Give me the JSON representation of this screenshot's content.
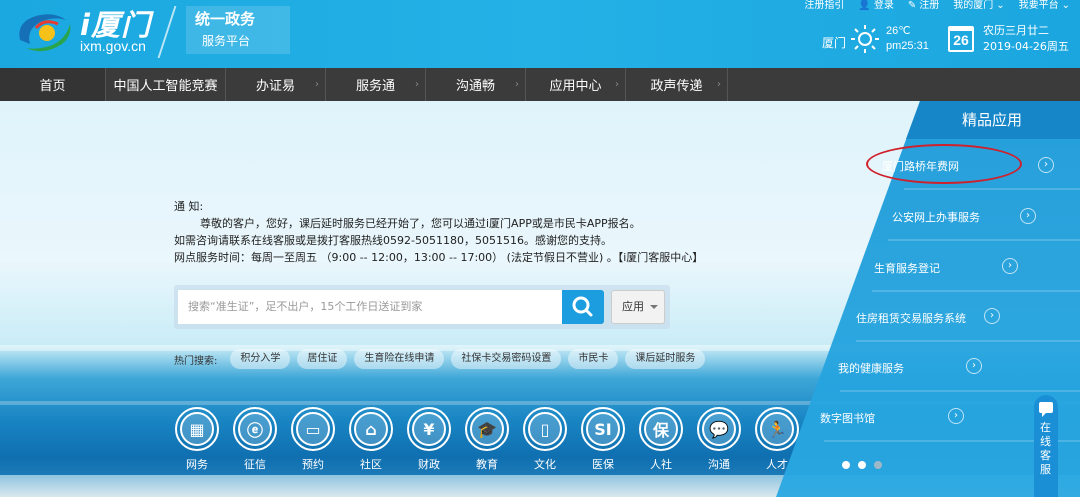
{
  "header": {
    "logo_title": "i厦门",
    "logo_domain": "ixm.gov.cn",
    "slogan_line1": "统一政务",
    "slogan_line2": "服务平台",
    "toplinks": [
      "注册指引",
      "登录",
      "注册",
      "我的厦门",
      "我要平台"
    ],
    "weather": {
      "city": "厦门",
      "temp": "26℃",
      "time": "pm25:31"
    },
    "calendar_day": "26",
    "lunar_date": "农历三月廿二",
    "solar_date": "2019-04-26周五"
  },
  "nav": {
    "items": [
      "首页",
      "中国人工智能竞赛",
      "办证易",
      "服务通",
      "沟通畅",
      "应用中心",
      "政声传递"
    ]
  },
  "notice": {
    "title": "通 知:",
    "line1": "尊敬的客户，您好，课后延时服务已经开始了，您可以通过i厦门APP或是市民卡APP报名。",
    "line2": "如需咨询请联系在线客服或是拨打客服热线0592-5051180，5051516。感谢您的支持。",
    "line3": "网点服务时间：每周一至周五 （9:00 -- 12:00，13:00 -- 17:00） (法定节假日不营业) 。【i厦门客服中心】"
  },
  "search": {
    "placeholder": "搜索“准生证”，足不出户，15个工作日送证到家",
    "select_value": "应用"
  },
  "hot": {
    "label": "热门搜索:",
    "tags": [
      "积分入学",
      "居住证",
      "生育险在线申请",
      "社保卡交易密码设置",
      "市民卡",
      "课后延时服务"
    ]
  },
  "services": [
    "网务",
    "征信",
    "预约",
    "社区",
    "财政",
    "教育",
    "文化",
    "医保",
    "人社",
    "沟通",
    "人才"
  ],
  "panel": {
    "title": "精品应用",
    "items": [
      "厦门路桥年费网",
      "公安网上办事服务",
      "生育服务登记",
      "住房租赁交易服务系统",
      "我的健康服务",
      "数字图书馆"
    ]
  },
  "kefu_label": "在线客服",
  "colors": {
    "brand_blue": "#1ba8e0",
    "nav_bg": "#3b3b3b",
    "highlight_red": "#d0202b"
  }
}
